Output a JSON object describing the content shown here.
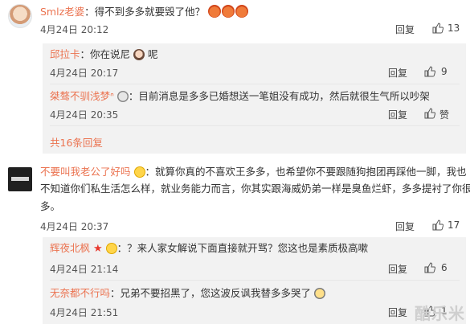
{
  "comments": [
    {
      "user": "Smlz老婆",
      "text": "：得不到多多就要毁了他？",
      "time": "4月24日 20:12",
      "reply_label": "回复",
      "like_count": "13",
      "emojis": [
        "angry-face-emoji",
        "angry-face-emoji",
        "angry-face-emoji"
      ]
    },
    {
      "user": "不要叫我老公了好吗",
      "text_line1": "：就算你真的不喜欢王多多，也希望你不要跟随狗抱团再踩他一脚，我也",
      "text_line2": "不知道你们私生活怎么样，就业务能力而言，你其实跟海威奶弟一样是臭鱼烂虾，多多提衬了你很",
      "text_line3": "多。",
      "time": "4月24日 20:37",
      "reply_label": "回复",
      "like_count": "17"
    }
  ],
  "replies_block1": [
    {
      "user": "邱拉卡",
      "text": "：你在说尼",
      "text_after": "呢",
      "time": "4月24日 20:17",
      "reply_label": "回复",
      "like_count": "9"
    },
    {
      "user": "桀骜不驯浅梦ᐢ",
      "text": "：目前消息是多多已婚想送一笔姐没有成功，然后就很生气所以吵架",
      "time": "4月24日 20:35",
      "reply_label": "回复",
      "like_label": "赞"
    }
  ],
  "more_replies": "共16条回复",
  "replies_block2": [
    {
      "user": "辉夜北枫",
      "text": "：？来人家女解说下面直接就开骂？您这也是素质极高嗽",
      "time": "4月24日 21:14",
      "reply_label": "回复",
      "like_count": "6"
    },
    {
      "user": "无奈都不行吗",
      "text": "：兄弟不要招黑了，您这波反讽我替多多哭了",
      "time": "4月24日 21:51",
      "reply_label": "回复",
      "like_count": "1"
    }
  ],
  "watermark": "酷乐米"
}
